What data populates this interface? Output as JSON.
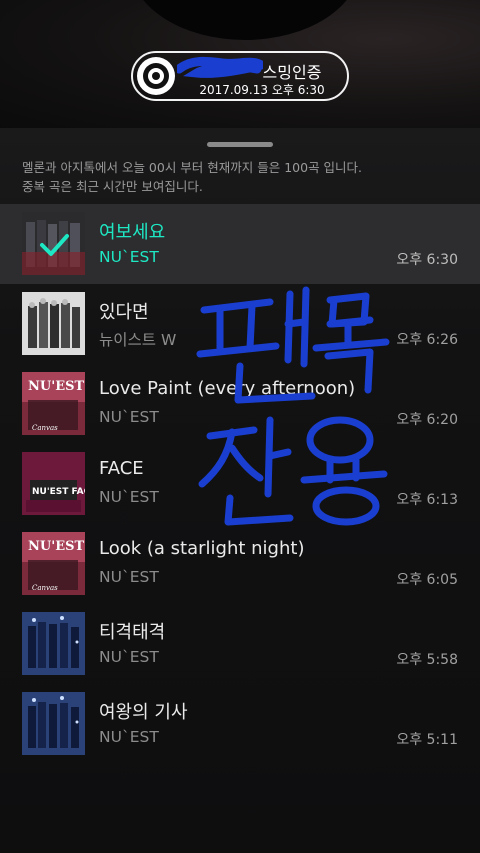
{
  "header": {
    "title_visible": "스밍인증",
    "datetime": "2017.09.13 오후 6:30"
  },
  "notice": {
    "line1": "멜론과 아지톡에서 오늘 00시 부터 현재까지 들은 100곡 입니다.",
    "line2": "중복 곡은 최근 시간만 보여집니다."
  },
  "tracks": [
    {
      "title": "여보세요",
      "artist": "NU`EST",
      "time": "오후 6:30",
      "selected": true
    },
    {
      "title": "있다면",
      "artist": "뉴이스트 W",
      "time": "오후 6:26"
    },
    {
      "title": "Love Paint (every afternoon)",
      "artist": "NU`EST",
      "time": "오후 6:20"
    },
    {
      "title": "FACE",
      "artist": "NU`EST",
      "time": "오후 6:13"
    },
    {
      "title": "Look (a starlight night)",
      "artist": "NU`EST",
      "time": "오후 6:05"
    },
    {
      "title": "티격태격",
      "artist": "NU`EST",
      "time": "오후 5:58"
    },
    {
      "title": "여왕의 기사",
      "artist": "NU`EST",
      "time": "오후 5:11"
    }
  ],
  "colors": {
    "accent": "#1ee8c4",
    "background": "#0d0d0e",
    "selected_row": "#2d2d2f",
    "scribble": "#1a3fd0"
  }
}
